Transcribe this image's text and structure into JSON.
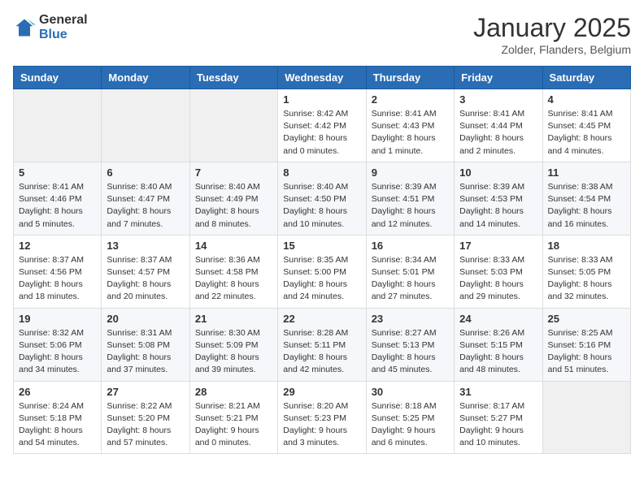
{
  "header": {
    "logo_general": "General",
    "logo_blue": "Blue",
    "month": "January 2025",
    "location": "Zolder, Flanders, Belgium"
  },
  "weekdays": [
    "Sunday",
    "Monday",
    "Tuesday",
    "Wednesday",
    "Thursday",
    "Friday",
    "Saturday"
  ],
  "weeks": [
    [
      {
        "day": "",
        "info": ""
      },
      {
        "day": "",
        "info": ""
      },
      {
        "day": "",
        "info": ""
      },
      {
        "day": "1",
        "info": "Sunrise: 8:42 AM\nSunset: 4:42 PM\nDaylight: 8 hours\nand 0 minutes."
      },
      {
        "day": "2",
        "info": "Sunrise: 8:41 AM\nSunset: 4:43 PM\nDaylight: 8 hours\nand 1 minute."
      },
      {
        "day": "3",
        "info": "Sunrise: 8:41 AM\nSunset: 4:44 PM\nDaylight: 8 hours\nand 2 minutes."
      },
      {
        "day": "4",
        "info": "Sunrise: 8:41 AM\nSunset: 4:45 PM\nDaylight: 8 hours\nand 4 minutes."
      }
    ],
    [
      {
        "day": "5",
        "info": "Sunrise: 8:41 AM\nSunset: 4:46 PM\nDaylight: 8 hours\nand 5 minutes."
      },
      {
        "day": "6",
        "info": "Sunrise: 8:40 AM\nSunset: 4:47 PM\nDaylight: 8 hours\nand 7 minutes."
      },
      {
        "day": "7",
        "info": "Sunrise: 8:40 AM\nSunset: 4:49 PM\nDaylight: 8 hours\nand 8 minutes."
      },
      {
        "day": "8",
        "info": "Sunrise: 8:40 AM\nSunset: 4:50 PM\nDaylight: 8 hours\nand 10 minutes."
      },
      {
        "day": "9",
        "info": "Sunrise: 8:39 AM\nSunset: 4:51 PM\nDaylight: 8 hours\nand 12 minutes."
      },
      {
        "day": "10",
        "info": "Sunrise: 8:39 AM\nSunset: 4:53 PM\nDaylight: 8 hours\nand 14 minutes."
      },
      {
        "day": "11",
        "info": "Sunrise: 8:38 AM\nSunset: 4:54 PM\nDaylight: 8 hours\nand 16 minutes."
      }
    ],
    [
      {
        "day": "12",
        "info": "Sunrise: 8:37 AM\nSunset: 4:56 PM\nDaylight: 8 hours\nand 18 minutes."
      },
      {
        "day": "13",
        "info": "Sunrise: 8:37 AM\nSunset: 4:57 PM\nDaylight: 8 hours\nand 20 minutes."
      },
      {
        "day": "14",
        "info": "Sunrise: 8:36 AM\nSunset: 4:58 PM\nDaylight: 8 hours\nand 22 minutes."
      },
      {
        "day": "15",
        "info": "Sunrise: 8:35 AM\nSunset: 5:00 PM\nDaylight: 8 hours\nand 24 minutes."
      },
      {
        "day": "16",
        "info": "Sunrise: 8:34 AM\nSunset: 5:01 PM\nDaylight: 8 hours\nand 27 minutes."
      },
      {
        "day": "17",
        "info": "Sunrise: 8:33 AM\nSunset: 5:03 PM\nDaylight: 8 hours\nand 29 minutes."
      },
      {
        "day": "18",
        "info": "Sunrise: 8:33 AM\nSunset: 5:05 PM\nDaylight: 8 hours\nand 32 minutes."
      }
    ],
    [
      {
        "day": "19",
        "info": "Sunrise: 8:32 AM\nSunset: 5:06 PM\nDaylight: 8 hours\nand 34 minutes."
      },
      {
        "day": "20",
        "info": "Sunrise: 8:31 AM\nSunset: 5:08 PM\nDaylight: 8 hours\nand 37 minutes."
      },
      {
        "day": "21",
        "info": "Sunrise: 8:30 AM\nSunset: 5:09 PM\nDaylight: 8 hours\nand 39 minutes."
      },
      {
        "day": "22",
        "info": "Sunrise: 8:28 AM\nSunset: 5:11 PM\nDaylight: 8 hours\nand 42 minutes."
      },
      {
        "day": "23",
        "info": "Sunrise: 8:27 AM\nSunset: 5:13 PM\nDaylight: 8 hours\nand 45 minutes."
      },
      {
        "day": "24",
        "info": "Sunrise: 8:26 AM\nSunset: 5:15 PM\nDaylight: 8 hours\nand 48 minutes."
      },
      {
        "day": "25",
        "info": "Sunrise: 8:25 AM\nSunset: 5:16 PM\nDaylight: 8 hours\nand 51 minutes."
      }
    ],
    [
      {
        "day": "26",
        "info": "Sunrise: 8:24 AM\nSunset: 5:18 PM\nDaylight: 8 hours\nand 54 minutes."
      },
      {
        "day": "27",
        "info": "Sunrise: 8:22 AM\nSunset: 5:20 PM\nDaylight: 8 hours\nand 57 minutes."
      },
      {
        "day": "28",
        "info": "Sunrise: 8:21 AM\nSunset: 5:21 PM\nDaylight: 9 hours\nand 0 minutes."
      },
      {
        "day": "29",
        "info": "Sunrise: 8:20 AM\nSunset: 5:23 PM\nDaylight: 9 hours\nand 3 minutes."
      },
      {
        "day": "30",
        "info": "Sunrise: 8:18 AM\nSunset: 5:25 PM\nDaylight: 9 hours\nand 6 minutes."
      },
      {
        "day": "31",
        "info": "Sunrise: 8:17 AM\nSunset: 5:27 PM\nDaylight: 9 hours\nand 10 minutes."
      },
      {
        "day": "",
        "info": ""
      }
    ]
  ]
}
